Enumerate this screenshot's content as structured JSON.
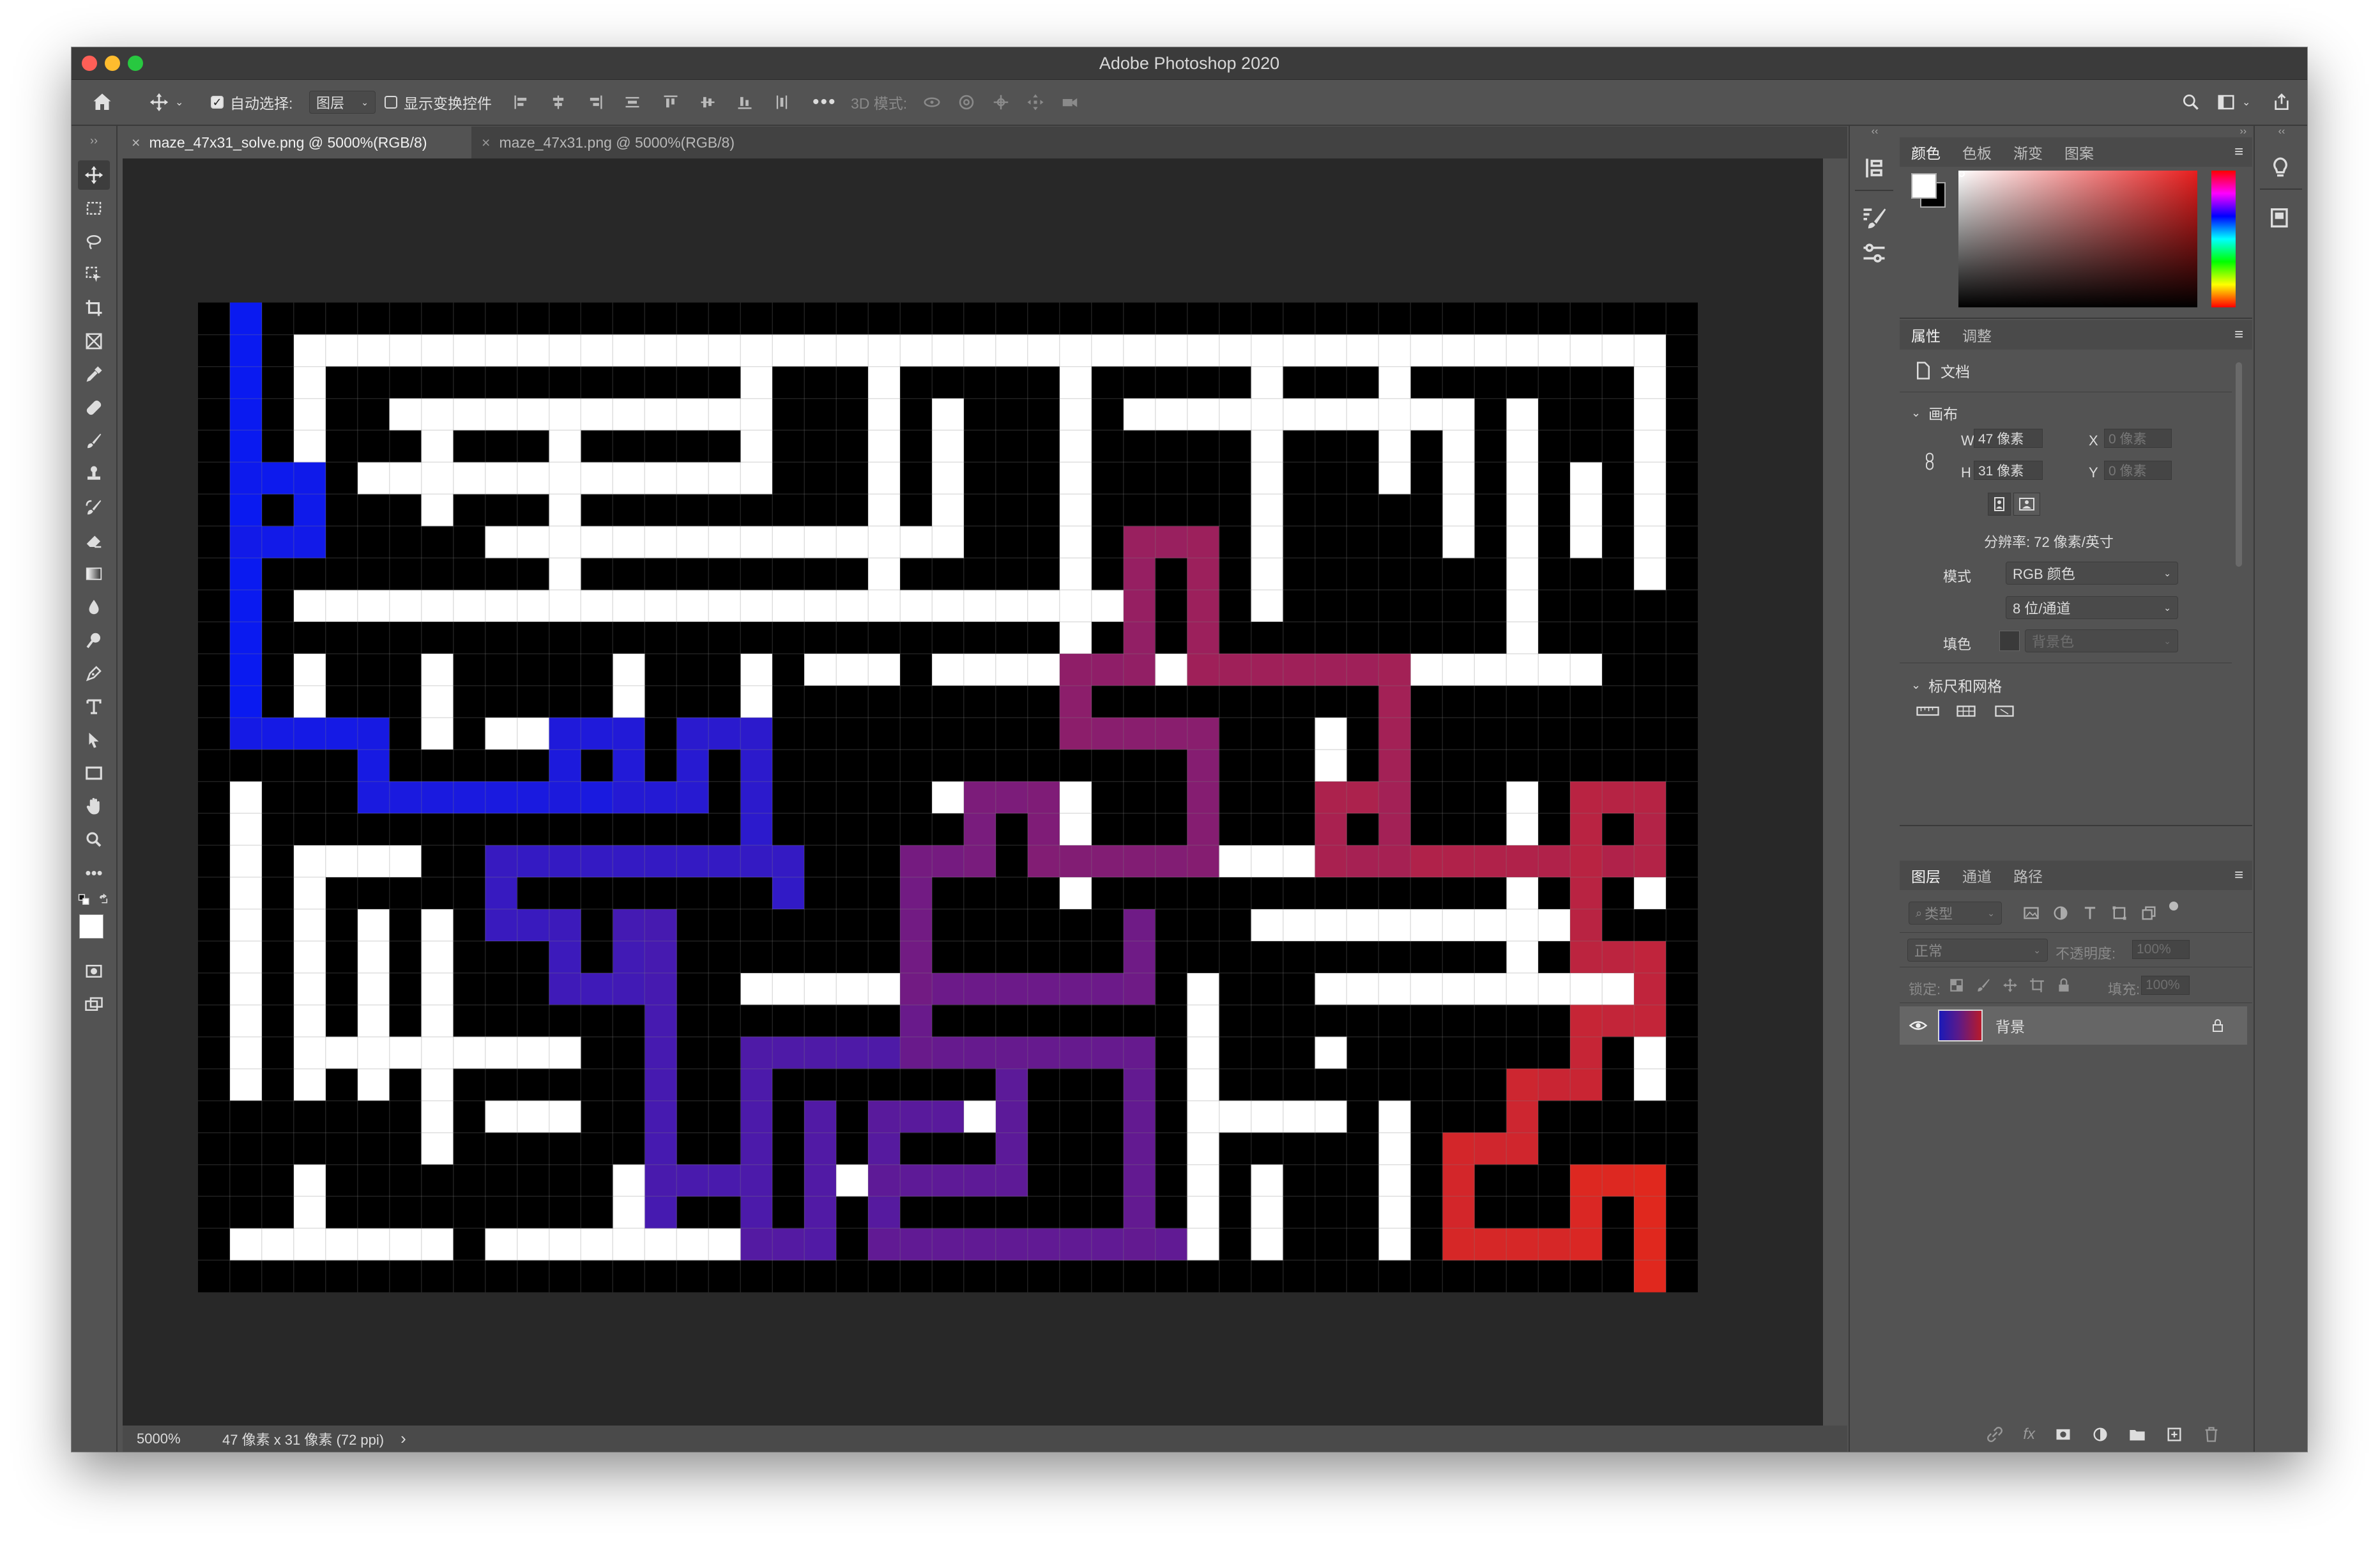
{
  "window": {
    "title": "Adobe Photoshop 2020"
  },
  "options_bar": {
    "auto_select_label": "自动选择:",
    "auto_select_value": "图层",
    "show_transform_label": "显示变换控件",
    "mode_3d_label": "3D 模式:"
  },
  "tabs": [
    {
      "label": "maze_47x31_solve.png @ 5000%(RGB/8)",
      "close": "×",
      "active": true
    },
    {
      "label": "maze_47x31.png @ 5000%(RGB/8)",
      "close": "×",
      "active": false
    }
  ],
  "status": {
    "zoom": "5000%",
    "doc_info": "47 像素 x 31 像素 (72 ppi)",
    "arrow": "›"
  },
  "color_panel": {
    "tabs": [
      "颜色",
      "色板",
      "渐变",
      "图案"
    ]
  },
  "properties_panel": {
    "tabs": [
      "属性",
      "调整"
    ],
    "doc_label": "文档",
    "canvas_section": "画布",
    "w_label": "W",
    "w_value": "47 像素",
    "h_label": "H",
    "h_value": "31 像素",
    "x_label": "X",
    "x_value": "0 像素",
    "y_label": "Y",
    "y_value": "0 像素",
    "resolution": "分辨率: 72 像素/英寸",
    "mode_label": "模式",
    "mode_value": "RGB 颜色",
    "depth_value": "8 位/通道",
    "fill_label": "填色",
    "fill_value": "背景色",
    "rulers_section": "标尺和网格"
  },
  "layers_panel": {
    "tabs": [
      "图层",
      "通道",
      "路径"
    ],
    "filter_label": "类型",
    "blend_mode": "正常",
    "opacity_label": "不透明度:",
    "opacity_value": "100%",
    "lock_label": "锁定:",
    "fill_label": "填充:",
    "fill_value": "100%",
    "layers": [
      {
        "name": "背景",
        "visible": true,
        "locked": true
      }
    ]
  },
  "colors": {
    "path_start": "#0a1af0",
    "path_mid": "#6a1a8a",
    "path_end": "#e0281e",
    "wall": "#000000",
    "passage": "#ffffff"
  },
  "maze": {
    "cols": 47,
    "rows": 31,
    "rows_data": [
      "...............................................",
      ".X.............................................",
      ".X...................................................",
      ".X.....................................",
      ".X.......",
      "",
      "",
      "",
      "",
      "",
      "",
      "",
      "",
      "",
      "",
      "",
      "",
      "",
      "",
      "",
      "",
      "",
      "",
      "",
      "",
      "",
      "",
      "",
      "",
      "",
      ""
    ]
  }
}
